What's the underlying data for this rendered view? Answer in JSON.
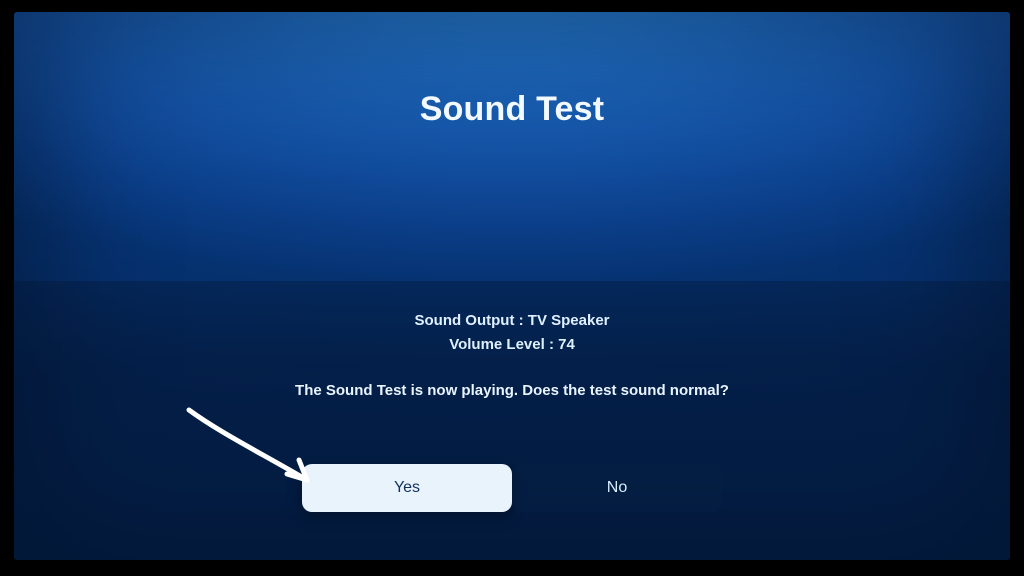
{
  "title": "Sound Test",
  "info": {
    "output_label": "Sound Output",
    "output_value": "TV Speaker",
    "volume_label": "Volume Level",
    "volume_value": "74"
  },
  "prompt": "The Sound Test is now playing. Does the test sound normal?",
  "buttons": {
    "yes": "Yes",
    "no": "No"
  }
}
